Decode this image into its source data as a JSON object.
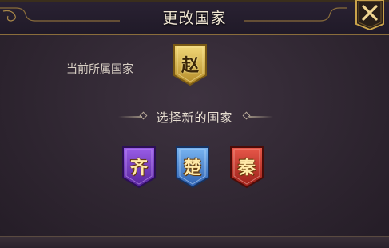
{
  "dialog": {
    "title": "更改国家",
    "close_icon": "close-x-icon",
    "colors": {
      "gold": "#c9a24a",
      "frame": "#8a6d3b",
      "panel": "#2e2530"
    }
  },
  "current": {
    "label": "当前所属国家",
    "country": {
      "glyph": "赵",
      "color": "#d8b84a"
    }
  },
  "choose": {
    "title": "选择新的国家",
    "options": [
      {
        "glyph": "齐",
        "color": "#7a3ec8"
      },
      {
        "glyph": "楚",
        "color": "#4a88d8"
      },
      {
        "glyph": "秦",
        "color": "#c8342a"
      }
    ]
  }
}
